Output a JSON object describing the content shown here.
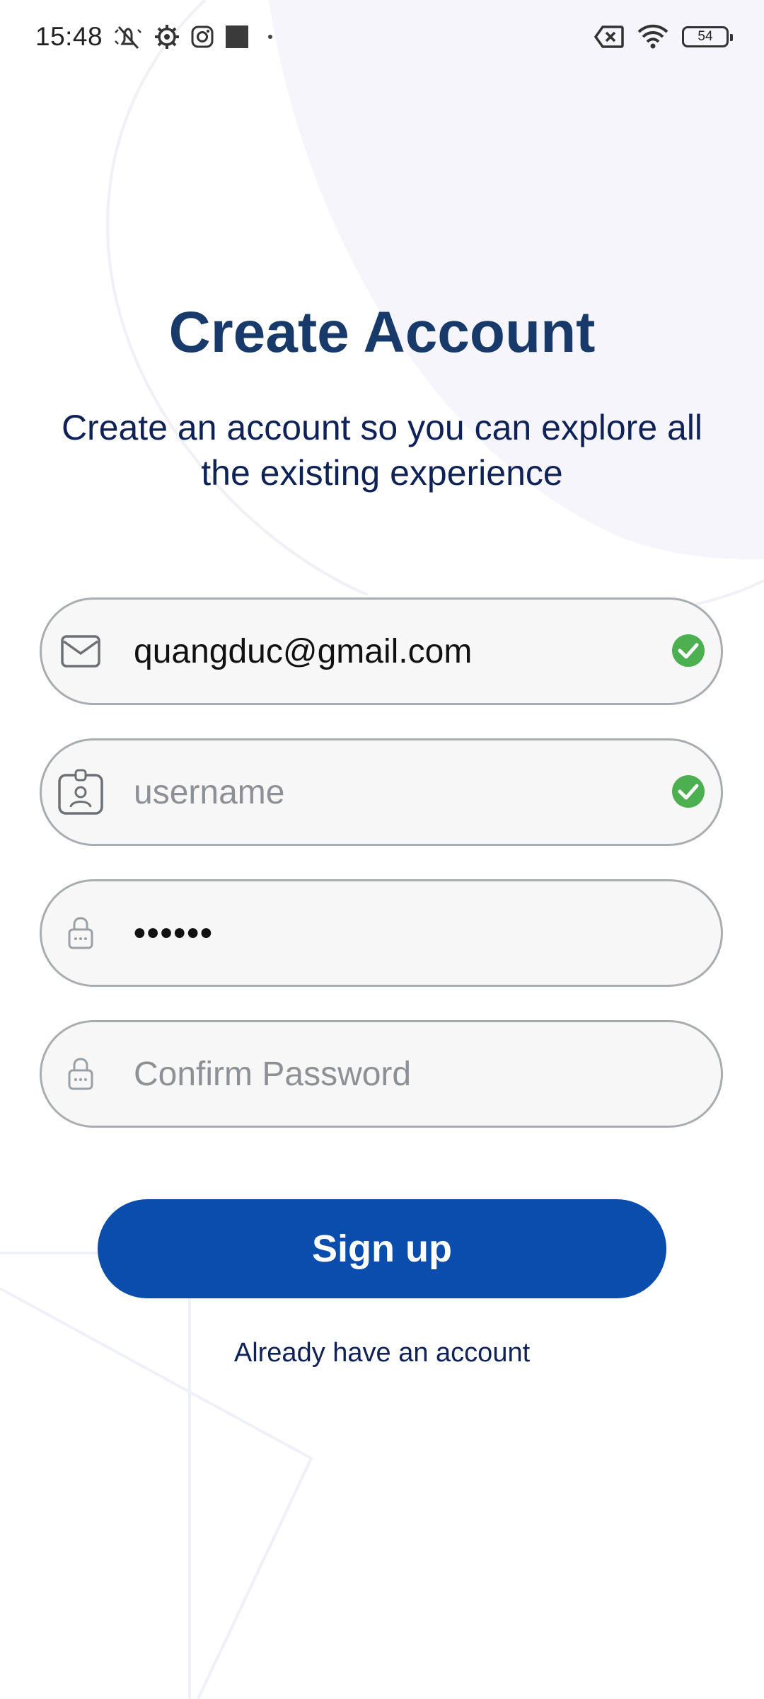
{
  "status_bar": {
    "time": "15:48",
    "battery_level": "54",
    "icons_left": [
      "mute-icon",
      "settings-icon",
      "instagram-icon",
      "square-notification-icon",
      "dot-icon"
    ],
    "icons_right": [
      "no-sim-icon",
      "wifi-icon",
      "battery-icon"
    ]
  },
  "header": {
    "title": "Create Account",
    "subtitle": "Create an account so you can explore all the existing experience"
  },
  "form": {
    "email": {
      "value": "quangduc@gmail.com",
      "icon": "mail-icon",
      "valid": true
    },
    "username": {
      "placeholder": "username",
      "icon": "id-badge-icon",
      "valid": true
    },
    "password": {
      "masked_value": "••••••",
      "icon": "lock-icon"
    },
    "confirm_password": {
      "placeholder": "Confirm Password",
      "icon": "lock-icon"
    }
  },
  "actions": {
    "signup_label": "Sign up",
    "login_link": "Already have an account"
  },
  "colors": {
    "title": "#183a6b",
    "subtitle": "#0f2257",
    "button_bg": "#0a4dad",
    "check_green": "#4caf50",
    "field_border": "#a8aeb0",
    "field_bg": "#f7f7f7"
  }
}
